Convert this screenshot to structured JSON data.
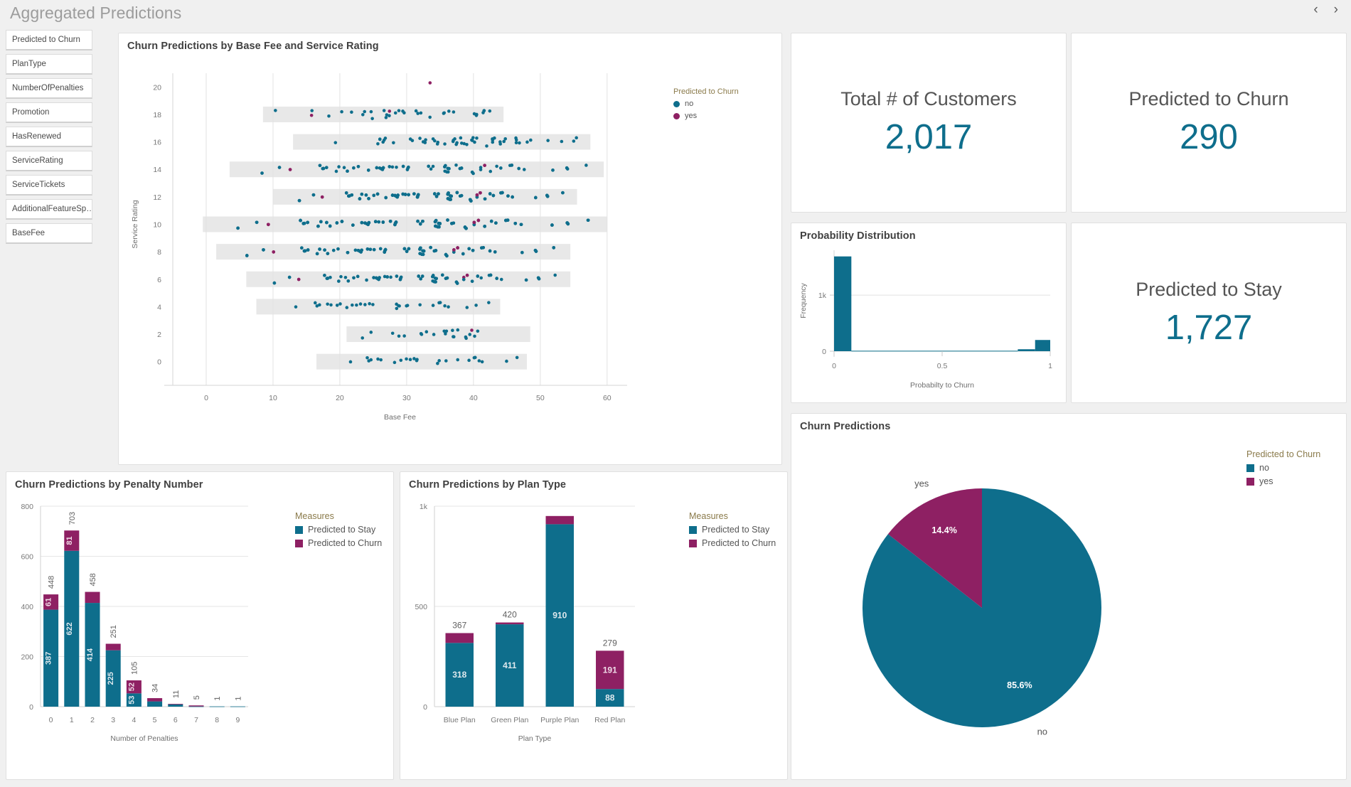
{
  "header": {
    "title": "Aggregated Predictions",
    "prev_label": "‹",
    "next_label": "›"
  },
  "colors": {
    "stay": "#0e6e8c",
    "churn": "#8e2063",
    "background": "#f0f0f0",
    "card": "#ffffff",
    "band": "#e8e8e8"
  },
  "sidebar": {
    "items": [
      {
        "label": "Predicted to Churn"
      },
      {
        "label": "PlanType"
      },
      {
        "label": "NumberOfPenalties"
      },
      {
        "label": "Promotion"
      },
      {
        "label": "HasRenewed"
      },
      {
        "label": "ServiceRating"
      },
      {
        "label": "ServiceTickets"
      },
      {
        "label": "AdditionalFeatureSp…"
      },
      {
        "label": "BaseFee"
      }
    ]
  },
  "kpis": {
    "total_customers": {
      "label": "Total # of Customers",
      "value": "2,017"
    },
    "predicted_churn": {
      "label": "Predicted to Churn",
      "value": "290"
    },
    "predicted_stay": {
      "label": "Predicted to Stay",
      "value": "1,727"
    }
  },
  "scatter": {
    "title": "Churn Predictions by Base Fee and Service Rating",
    "legend_title": "Predicted to Churn",
    "legend": [
      {
        "label": "no",
        "color": "#0e6e8c"
      },
      {
        "label": "yes",
        "color": "#8e2063"
      }
    ]
  },
  "histogram": {
    "title": "Probability Distribution"
  },
  "penalty_chart": {
    "title": "Churn Predictions by Penalty Number",
    "legend_title": "Measures",
    "legend": [
      {
        "label": "Predicted to Stay",
        "color": "#0e6e8c"
      },
      {
        "label": "Predicted to Churn",
        "color": "#8e2063"
      }
    ]
  },
  "plan_chart": {
    "title": "Churn Predictions by Plan Type",
    "legend_title": "Measures",
    "legend": [
      {
        "label": "Predicted to Stay",
        "color": "#0e6e8c"
      },
      {
        "label": "Predicted to Churn",
        "color": "#8e2063"
      }
    ]
  },
  "pie_chart": {
    "title": "Churn Predictions",
    "legend_title": "Predicted to Churn",
    "legend": [
      {
        "label": "no",
        "color": "#0e6e8c"
      },
      {
        "label": "yes",
        "color": "#8e2063"
      }
    ]
  },
  "chart_data": [
    {
      "id": "scatter_base_fee_service_rating",
      "type": "scatter",
      "title": "Churn Predictions by Base Fee and Service Rating",
      "xlabel": "Base Fee",
      "ylabel": "Service Rating",
      "xlim": [
        -5,
        63
      ],
      "ylim": [
        -1,
        21
      ],
      "xticks": [
        0,
        10,
        20,
        30,
        40,
        50,
        60
      ],
      "yticks": [
        0,
        2,
        4,
        6,
        8,
        10,
        12,
        14,
        16,
        18,
        20
      ],
      "grid": true,
      "legend_title": "Predicted to Churn",
      "legend_position": "right",
      "series": [
        {
          "name": "no",
          "color": "#0e6e8c"
        },
        {
          "name": "yes",
          "color": "#8e2063"
        }
      ],
      "bands": [
        {
          "rating": 18,
          "x_start": 8.5,
          "x_end": 44.5
        },
        {
          "rating": 16,
          "x_start": 13.0,
          "x_end": 57.5
        },
        {
          "rating": 14,
          "x_start": 3.5,
          "x_end": 59.5
        },
        {
          "rating": 12,
          "x_start": 10.0,
          "x_end": 55.5
        },
        {
          "rating": 10,
          "x_start": -0.5,
          "x_end": 60.0
        },
        {
          "rating": 8,
          "x_start": 1.5,
          "x_end": 54.5
        },
        {
          "rating": 6,
          "x_start": 6.0,
          "x_end": 54.5
        },
        {
          "rating": 4,
          "x_start": 7.5,
          "x_end": 44.0
        },
        {
          "rating": 2,
          "x_start": 21.0,
          "x_end": 48.5
        },
        {
          "rating": 0,
          "x_start": 16.5,
          "x_end": 48.0
        }
      ],
      "points_note": "approximately 2017 jittered points; density peaks at ratings 10 and 12"
    },
    {
      "id": "probability_distribution",
      "type": "bar",
      "title": "Probability Distribution",
      "xlabel": "Probabilty to Churn",
      "ylabel": "Frequency",
      "xticks": [
        0,
        0.5,
        1
      ],
      "xtick_labels": [
        "0",
        "0.5",
        "1"
      ],
      "yticks": [
        0,
        1000
      ],
      "ytick_labels": [
        "0",
        "1k"
      ],
      "ylim": [
        0,
        1800
      ],
      "grid": true,
      "bins": [
        {
          "x_start": 0.0,
          "x_end": 0.08,
          "value": 1690
        },
        {
          "x_start": 0.08,
          "x_end": 0.85,
          "value": 8
        },
        {
          "x_start": 0.85,
          "x_end": 0.93,
          "value": 35
        },
        {
          "x_start": 0.93,
          "x_end": 1.0,
          "value": 200
        }
      ]
    },
    {
      "id": "churn_by_penalty_number",
      "type": "bar",
      "stacked": true,
      "title": "Churn Predictions by Penalty Number",
      "xlabel": "Number of Penalties",
      "ylabel": "",
      "categories": [
        "0",
        "1",
        "2",
        "3",
        "4",
        "5",
        "6",
        "7",
        "8",
        "9"
      ],
      "yticks": [
        0,
        200,
        400,
        600,
        800
      ],
      "ylim": [
        0,
        800
      ],
      "grid": true,
      "legend_title": "Measures",
      "legend_position": "right",
      "series": [
        {
          "name": "Predicted to Stay",
          "color": "#0e6e8c",
          "values": [
            387,
            622,
            414,
            225,
            53,
            21,
            10,
            1,
            1,
            1
          ]
        },
        {
          "name": "Predicted to Churn",
          "color": "#8e2063",
          "values": [
            61,
            81,
            44,
            26,
            52,
            13,
            1,
            4,
            0,
            0
          ]
        }
      ],
      "totals": [
        448,
        703,
        458,
        251,
        105,
        34,
        11,
        5,
        1,
        1
      ],
      "stay_labels": [
        "387",
        "622",
        "414",
        "225",
        "53",
        "",
        "",
        "",
        "",
        ""
      ],
      "churn_labels": [
        "61",
        "81",
        "",
        "",
        "52",
        "",
        "",
        "",
        "",
        ""
      ],
      "total_labels": [
        "448",
        "703",
        "458",
        "251",
        "105",
        "34",
        "11",
        "5",
        "1",
        "1"
      ]
    },
    {
      "id": "churn_by_plan_type",
      "type": "bar",
      "stacked": true,
      "title": "Churn Predictions by Plan Type",
      "xlabel": "Plan Type",
      "ylabel": "",
      "categories": [
        "Blue Plan",
        "Green Plan",
        "Purple Plan",
        "Red Plan"
      ],
      "yticks": [
        0,
        500,
        1000
      ],
      "ytick_labels": [
        "0",
        "500",
        "1k"
      ],
      "ylim": [
        0,
        1000
      ],
      "grid": true,
      "legend_title": "Measures",
      "legend_position": "right",
      "series": [
        {
          "name": "Predicted to Stay",
          "color": "#0e6e8c",
          "values": [
            318,
            411,
            910,
            88
          ]
        },
        {
          "name": "Predicted to Churn",
          "color": "#8e2063",
          "values": [
            49,
            9,
            41,
            191
          ]
        }
      ],
      "totals": [
        367,
        420,
        951,
        279
      ],
      "stay_labels": [
        "318",
        "411",
        "910",
        "88"
      ],
      "churn_labels": [
        "",
        "",
        "",
        "191"
      ],
      "total_labels": [
        "367",
        "420",
        "",
        "279"
      ]
    },
    {
      "id": "churn_predictions_pie",
      "type": "pie",
      "title": "Churn Predictions",
      "legend_title": "Predicted to Churn",
      "legend_position": "right",
      "labels": [
        "no",
        "yes"
      ],
      "values": [
        85.6,
        14.4
      ],
      "value_labels": [
        "85.6%",
        "14.4%"
      ],
      "colors": [
        "#0e6e8c",
        "#8e2063"
      ]
    }
  ]
}
